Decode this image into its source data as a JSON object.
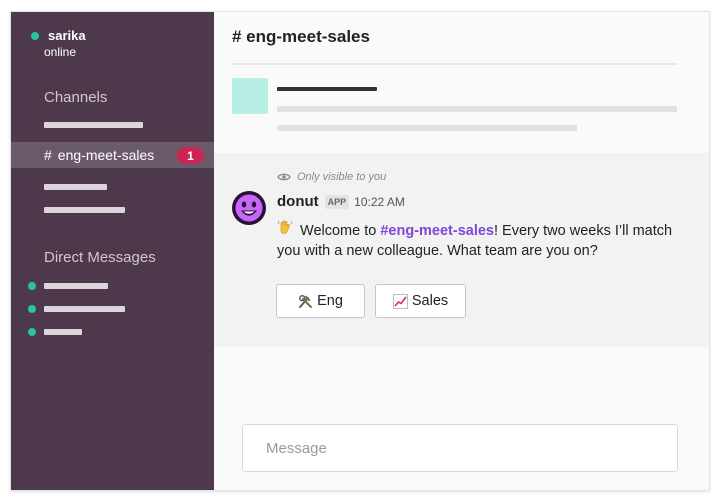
{
  "user": {
    "name": "sarika",
    "status": "online"
  },
  "sidebar": {
    "channels_title": "Channels",
    "active_channel": {
      "hash": "#",
      "name": "eng-meet-sales",
      "unread": "1"
    },
    "dm_title": "Direct Messages"
  },
  "channel": {
    "title": "# eng-meet-sales"
  },
  "message": {
    "visibility": "Only visible to you",
    "sender": "donut",
    "app_tag": "APP",
    "time": "10:22 AM",
    "text_before": " Welcome to ",
    "mention": "#eng-meet-sales",
    "text_after": "! Every two weeks I’ll match you with a new colleague. What team are you on?",
    "buttons": [
      {
        "label": "Eng",
        "icon": "hammer-wrench-icon"
      },
      {
        "label": "Sales",
        "icon": "chart-increasing-icon"
      }
    ]
  },
  "composer": {
    "placeholder": "Message"
  },
  "colors": {
    "sidebar_bg": "#4d394b",
    "presence": "#2bc3a8",
    "badge": "#cd2553",
    "mention": "#7e47d6",
    "bot_avatar": "#c667f5"
  }
}
